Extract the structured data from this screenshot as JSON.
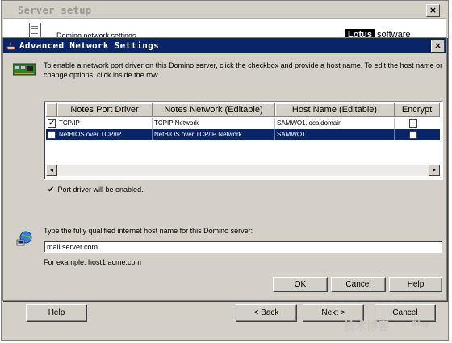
{
  "outer_window": {
    "title": "Server setup",
    "header_text": "Domino network settings",
    "brand_box": "Lotus",
    "brand_text": "software",
    "buttons": {
      "help": "Help",
      "back": "< Back",
      "next": "Next >",
      "cancel": "Cancel"
    },
    "close_glyph": "×"
  },
  "watermark": {
    "line1": "51CTO.com",
    "line2": "技术博客",
    "line3": "Blog"
  },
  "dialog": {
    "title": "Advanced Network Settings",
    "close_glyph": "×",
    "description": "To enable a network port driver on this Domino server, click the checkbox and provide a host name. To edit the host name or change options, click inside the row.",
    "table": {
      "columns": [
        "Notes Port Driver",
        "Notes Network (Editable)",
        "Host Name (Editable)",
        "Encrypt"
      ],
      "rows": [
        {
          "checked": true,
          "driver": "TCP/IP",
          "network": "TCPIP Network",
          "host": "SAMWO1.localdomain",
          "encrypt": false,
          "selected": false
        },
        {
          "checked": false,
          "driver": "NetBIOS over TCP/IP",
          "network": "NetBIOS over TCP/IP Network",
          "host": "SAMWO1",
          "encrypt": false,
          "selected": true
        }
      ],
      "scroll_left_glyph": "◂",
      "scroll_right_glyph": "▸"
    },
    "status_text": "Port driver will be enabled.",
    "status_checked": true,
    "host_label": "Type the fully qualified internet host name for this Domino server:",
    "host_value": "mail.server.com",
    "example_text": "For example: host1.acme.com",
    "buttons": {
      "ok": "OK",
      "cancel": "Cancel",
      "help": "Help"
    }
  },
  "colors": {
    "dialog_title_bg": "#0a246a",
    "selection_bg": "#0a246a",
    "face": "#d4d0c8"
  }
}
